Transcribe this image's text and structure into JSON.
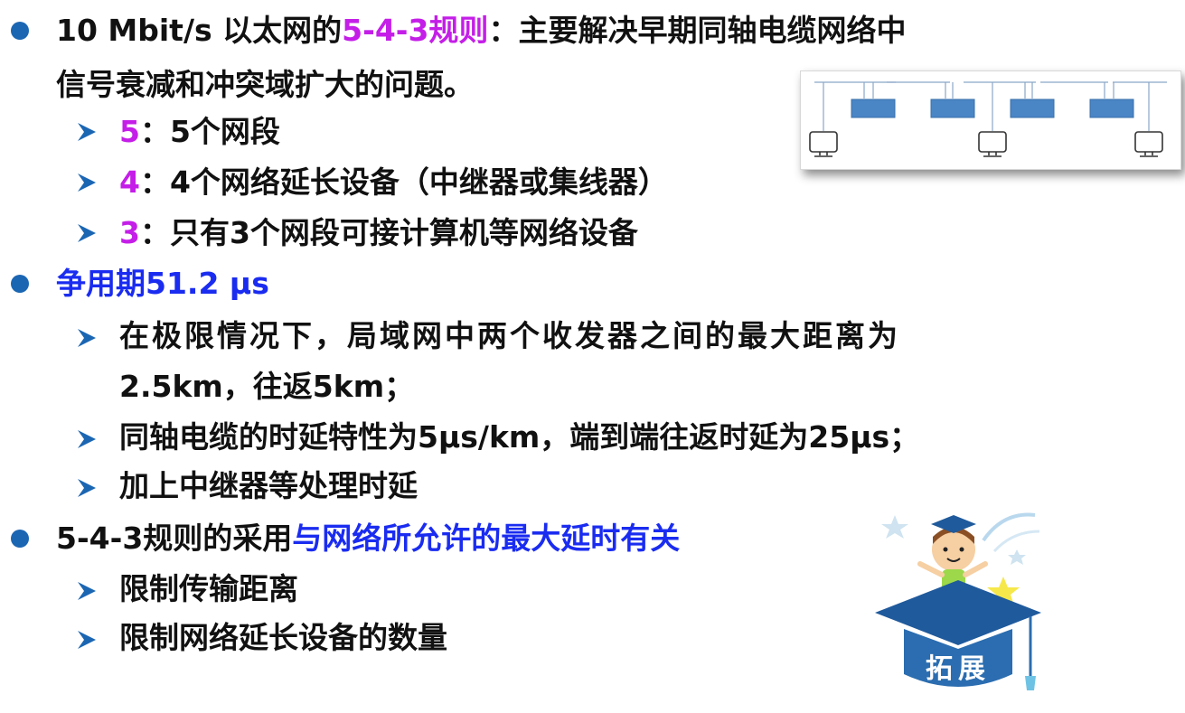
{
  "items": [
    {
      "parts": [
        "10  Mbit/s  以太网的",
        "5-4-3规则",
        "：主要解决早期同轴电缆网络中"
      ]
    },
    {
      "text": "信号衰减和冲突域扩大的问题。"
    },
    {
      "num": "5",
      "text": "：5个网段"
    },
    {
      "num": "4",
      "text": "：4个网络延长设备（中继器或集线器）"
    },
    {
      "num": "3",
      "text": "：只有3个网段可接计算机等网络设备"
    },
    {
      "text": "争用期51.2 μs"
    },
    {
      "text": "在极限情况下，局域网中两个收发器之间的最大距离为"
    },
    {
      "text": "2.5km，往返5km；"
    },
    {
      "text": "同轴电缆的时延特性为5μs/km，端到端往返时延为25μs；"
    },
    {
      "text": "加上中继器等处理时延"
    },
    {
      "parts": [
        "5-4-3规则的采用",
        "与网络所允许的最大延时有关"
      ]
    },
    {
      "text": "限制传输距离"
    },
    {
      "text": "限制网络延长设备的数量"
    }
  ],
  "badge": {
    "label": "拓展"
  },
  "colors": {
    "bullet": "#1b66b3",
    "purple": "#c41ee8",
    "blue": "#1a2cf0",
    "repeater": "#4a86c6",
    "cap": "#1f5a9c"
  },
  "icons": [
    "bullet-dot",
    "arrow-chevron",
    "network-diagram",
    "computer-icon",
    "graduate-badge"
  ]
}
